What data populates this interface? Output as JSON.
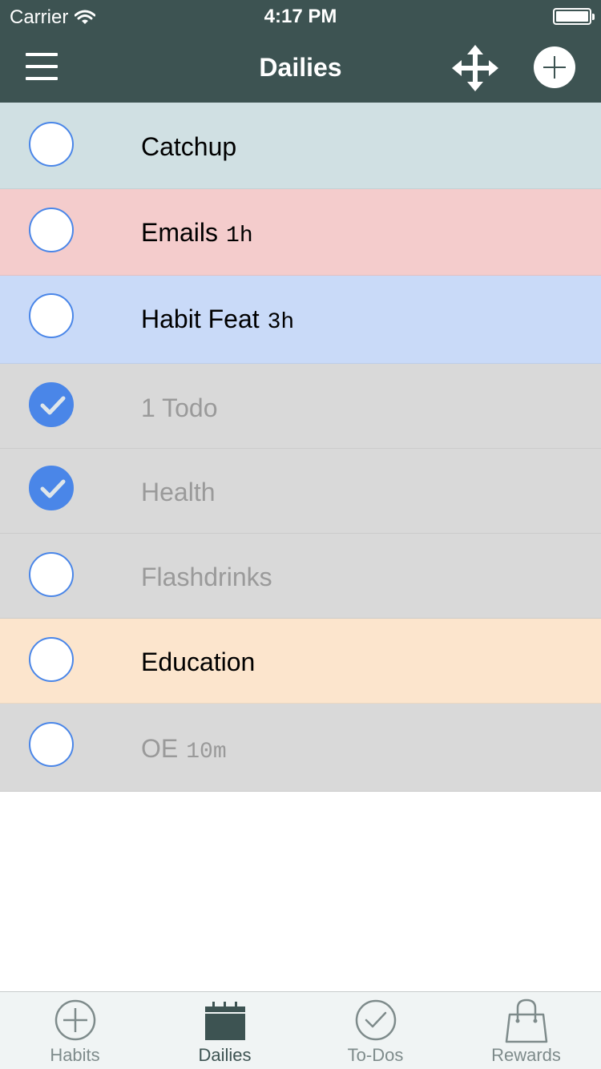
{
  "status": {
    "carrier": "Carrier",
    "time": "4:17 PM"
  },
  "nav": {
    "title": "Dailies"
  },
  "colors": {
    "header": "#3d5352",
    "check_blue": "#4a86e8"
  },
  "dailies": [
    {
      "title": "Catchup",
      "duration": "",
      "checked": false,
      "bg": "#d0e0e3",
      "text_color": "#000000"
    },
    {
      "title": "Emails",
      "duration": "1h",
      "checked": false,
      "bg": "#f4cccc",
      "text_color": "#000000"
    },
    {
      "title": "Habit Feat",
      "duration": "3h",
      "checked": false,
      "bg": "#c9daf8",
      "text_color": "#000000"
    },
    {
      "title": "1 Todo",
      "duration": "",
      "checked": true,
      "bg": "#d9d9d9",
      "text_color": "#9a9a9a"
    },
    {
      "title": "Health",
      "duration": "",
      "checked": true,
      "bg": "#d9d9d9",
      "text_color": "#9a9a9a"
    },
    {
      "title": "Flashdrinks",
      "duration": "",
      "checked": false,
      "bg": "#d9d9d9",
      "text_color": "#9a9a9a"
    },
    {
      "title": "Education",
      "duration": "",
      "checked": false,
      "bg": "#fce5cd",
      "text_color": "#000000"
    },
    {
      "title": "OE",
      "duration": "10m",
      "checked": false,
      "bg": "#d9d9d9",
      "text_color": "#9a9a9a"
    }
  ],
  "tabs": [
    {
      "label": "Habits",
      "icon": "plus-circle-icon",
      "active": false
    },
    {
      "label": "Dailies",
      "icon": "calendar-icon",
      "active": true
    },
    {
      "label": "To-Dos",
      "icon": "check-circle-icon",
      "active": false
    },
    {
      "label": "Rewards",
      "icon": "shopping-bag-icon",
      "active": false
    }
  ]
}
